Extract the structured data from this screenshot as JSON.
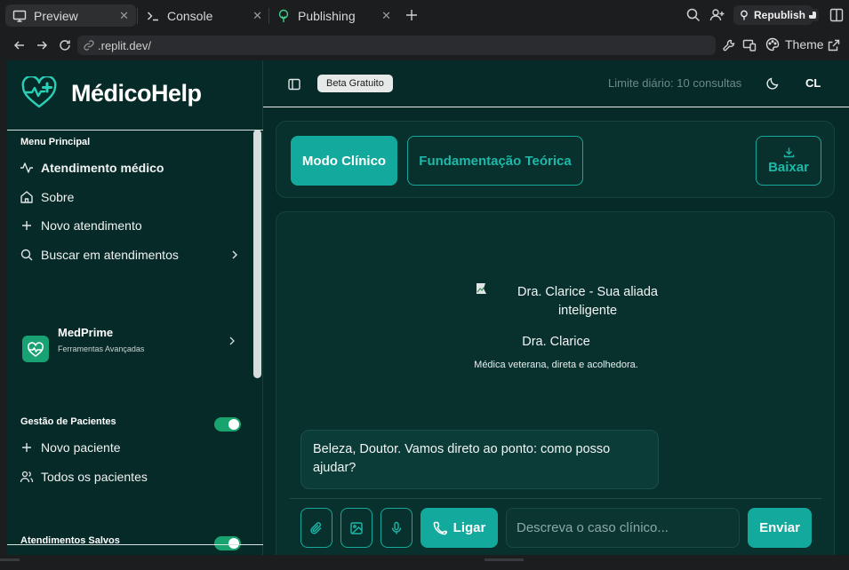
{
  "browser": {
    "tabs": [
      {
        "label": "Preview",
        "icon": "monitor-icon",
        "active": true
      },
      {
        "label": "Console",
        "icon": "terminal-icon",
        "active": false
      },
      {
        "label": "Publishing",
        "icon": "publish-icon",
        "active": false
      }
    ],
    "republish_label": "Republish",
    "url": ".replit.dev/",
    "theme_label": "Theme"
  },
  "sidebar": {
    "brand": "MédicoHelp",
    "menu_title": "Menu Principal",
    "menu_items": [
      {
        "label": "Atendimento médico",
        "icon": "activity-icon"
      },
      {
        "label": "Sobre",
        "icon": "home-icon"
      },
      {
        "label": "Novo atendimento",
        "icon": "plus-icon"
      },
      {
        "label": "Buscar em atendimentos",
        "icon": "search-icon"
      }
    ],
    "medprime": {
      "title": "MedPrime",
      "subtitle": "Ferramentas Avançadas"
    },
    "patients_title": "Gestão de Pacientes",
    "patient_items": [
      {
        "label": "Novo paciente",
        "icon": "plus-icon"
      },
      {
        "label": "Todos os pacientes",
        "icon": "users-icon"
      }
    ],
    "saved_title": "Atendimentos Salvos"
  },
  "header": {
    "badge": "Beta Gratuito",
    "limit": "Limite diário: 10 consultas",
    "avatar": "CL"
  },
  "modes": {
    "clinical": "Modo Clínico",
    "theory": "Fundamentação Teórica",
    "download": "Baixar"
  },
  "chat": {
    "image_alt": "Dra. Clarice - Sua aliada inteligente",
    "bot_name": "Dra. Clarice",
    "bot_description": "Médica veterana, direta e acolhedora.",
    "message": "Beleza, Doutor. Vamos direto ao ponto: como posso ajudar?",
    "call_label": "Ligar",
    "input_placeholder": "Descreva o caso clínico...",
    "send_label": "Enviar"
  },
  "colors": {
    "background": "#062a27",
    "accent": "#13a99c",
    "toggle": "#19a36f"
  }
}
